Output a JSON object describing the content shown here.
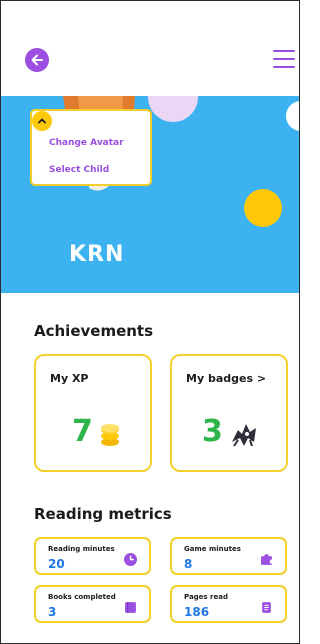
{
  "profile": {
    "name": "KRN"
  },
  "avatar_menu": {
    "change_avatar": "Change Avatar",
    "select_child": "Select Child"
  },
  "achievements": {
    "title": "Achievements",
    "my_xp": {
      "label": "My XP",
      "value": "7"
    },
    "my_badges": {
      "label": "My badges >",
      "value": "3"
    }
  },
  "reading_metrics": {
    "title": "Reading metrics",
    "items": [
      {
        "label": "Reading minutes",
        "value": "20",
        "icon": "clock-icon"
      },
      {
        "label": "Game minutes",
        "value": "8",
        "icon": "puzzle-icon"
      },
      {
        "label": "Books completed",
        "value": "3",
        "icon": "book-icon"
      },
      {
        "label": "Pages read",
        "value": "186",
        "icon": "pages-icon"
      }
    ]
  },
  "colors": {
    "accent_purple": "#9b4fe0",
    "hero_blue": "#3db2f0",
    "card_border": "#f4cf2c",
    "value_green": "#2db44a",
    "value_blue": "#1f78e5"
  }
}
